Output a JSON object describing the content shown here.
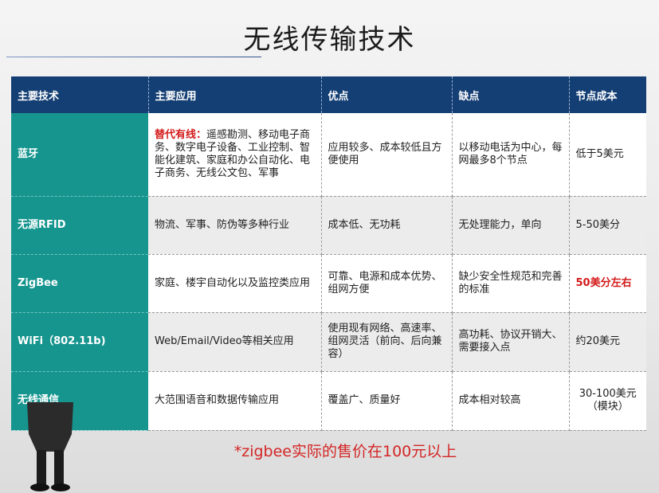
{
  "title": "无线传输技术",
  "table": {
    "headers": [
      "主要技术",
      "主要应用",
      "优点",
      "缺点",
      "节点成本"
    ],
    "rows": [
      {
        "tech": "蓝牙",
        "app_lead": "替代有线：",
        "app": "遥感勘测、移动电子商务、数字电子设备、工业控制、智能化建筑、家庭和办公自动化、电子商务、无线公文包、军事",
        "pros": "应用较多、成本较低且方便使用",
        "cons": "以移动电话为中心，每网最多8个节点",
        "cost": "低于5美元"
      },
      {
        "tech": "无源RFID",
        "app": "物流、军事、防伪等多种行业",
        "pros": "成本低、无功耗",
        "cons": "无处理能力，单向",
        "cost": "5-50美分"
      },
      {
        "tech": "ZigBee",
        "app": "家庭、楼宇自动化以及监控类应用",
        "pros": "可靠、电源和成本优势、组网方便",
        "cons": "缺少安全性规范和完善的标准",
        "cost": "50美分左右"
      },
      {
        "tech": "WiFi（802.11b)",
        "app": "Web/Email/Video等相关应用",
        "pros": "使用现有网络、高速率、组网灵活（前向、后向兼容）",
        "cons": "高功耗、协议开销大、需要接入点",
        "cost": "约20美元"
      },
      {
        "tech": "无线通信",
        "app": "大范围语音和数据传输应用",
        "pros": "覆盖广、质量好",
        "cons": "成本相对较高",
        "cost": "30-100美元（模块）"
      }
    ]
  },
  "note": "*zigbee实际的售价在100元以上",
  "colors": {
    "header_bg": "#143f74",
    "tech_col_bg": "#16958e",
    "highlight_red": "#d41a1a"
  }
}
